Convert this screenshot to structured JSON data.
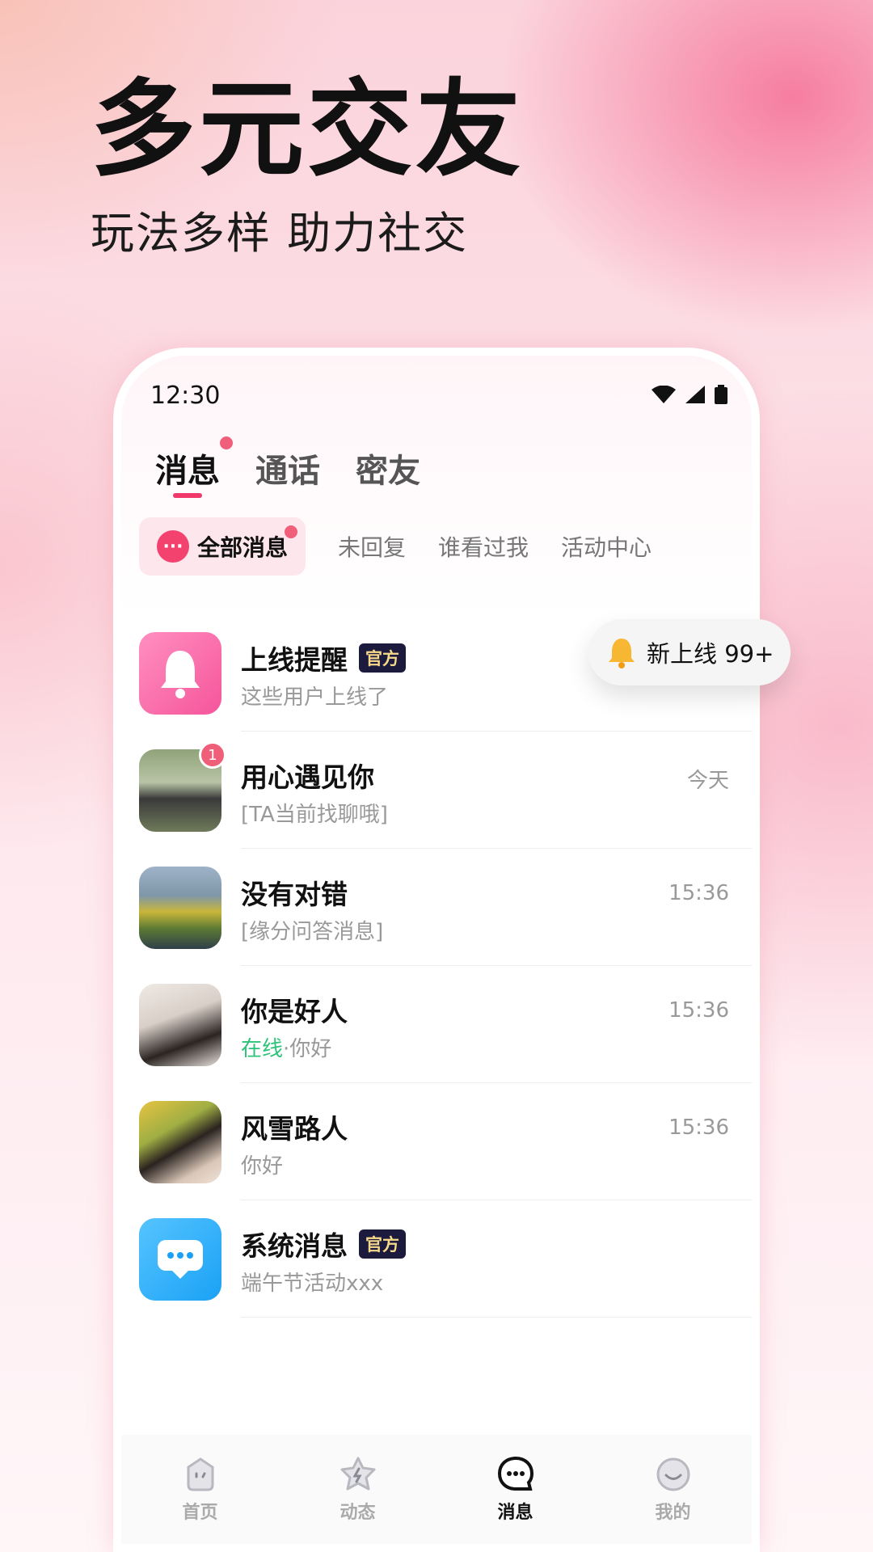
{
  "hero": {
    "title": "多元交友",
    "subtitle": "玩法多样 助力社交"
  },
  "status_bar": {
    "time": "12:30"
  },
  "tabs": [
    {
      "label": "消息",
      "active": true,
      "has_dot": true
    },
    {
      "label": "通话",
      "active": false
    },
    {
      "label": "密友",
      "active": false
    }
  ],
  "filters": {
    "all_label": "全部消息",
    "items": [
      "未回复",
      "谁看过我",
      "活动中心"
    ]
  },
  "floating_pill": {
    "text": "新上线 99+"
  },
  "messages": [
    {
      "name": "上线提醒",
      "official": "官方",
      "preview": "这些用户上线了",
      "time": ""
    },
    {
      "name": "用心遇见你",
      "preview": "[TA当前找聊哦]",
      "time": "今天",
      "unread": "1"
    },
    {
      "name": "没有对错",
      "preview": "[缘分问答消息]",
      "time": "15:36"
    },
    {
      "name": "你是好人",
      "status": "在线",
      "separator": "·",
      "preview": "你好",
      "time": "15:36"
    },
    {
      "name": "风雪路人",
      "preview": "你好",
      "time": "15:36"
    },
    {
      "name": "系统消息",
      "official": "官方",
      "preview": "端午节活动xxx",
      "time": ""
    }
  ],
  "bottom_nav": [
    {
      "label": "首页",
      "icon": "home-face-icon"
    },
    {
      "label": "动态",
      "icon": "star-bolt-icon"
    },
    {
      "label": "消息",
      "icon": "chat-bubble-icon",
      "active": true
    },
    {
      "label": "我的",
      "icon": "smile-icon"
    }
  ],
  "colors": {
    "accent": "#f0386b",
    "official_bg": "#1c1b3d",
    "official_text": "#f6d98a"
  }
}
